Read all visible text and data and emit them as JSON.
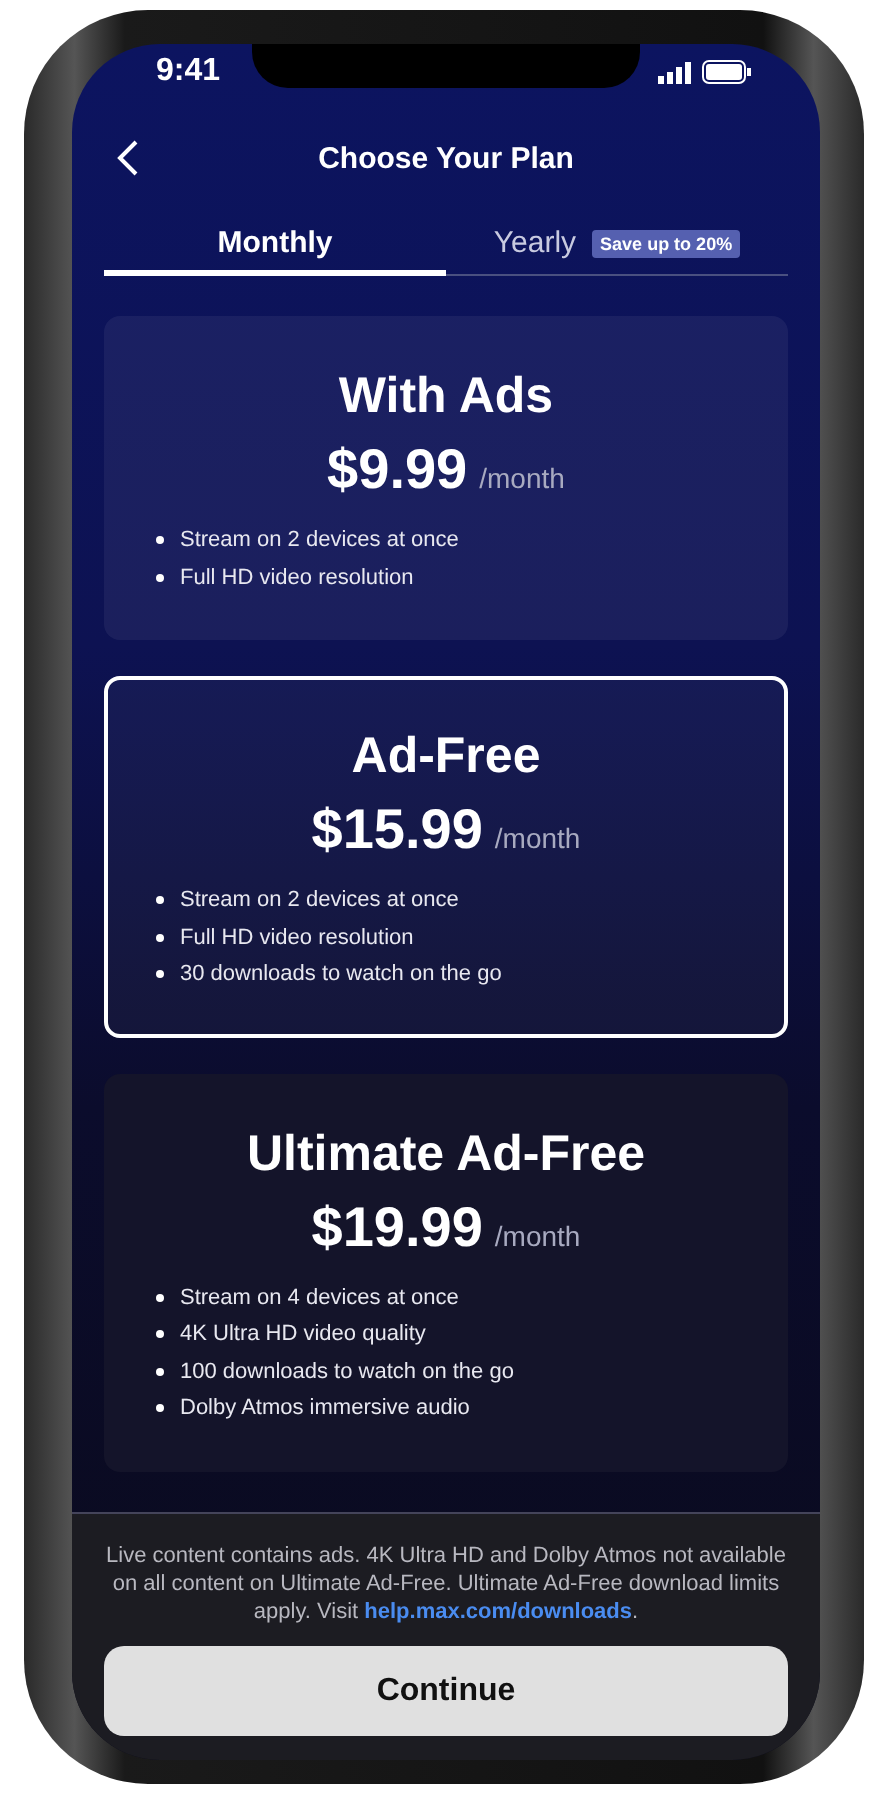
{
  "status_bar": {
    "time": "9:41"
  },
  "header": {
    "title": "Choose Your Plan"
  },
  "tabs": [
    {
      "label": "Monthly",
      "selected": true
    },
    {
      "label": "Yearly",
      "selected": false,
      "badge": "Save up to 20%"
    }
  ],
  "plans": [
    {
      "name": "With Ads",
      "price": "$9.99",
      "period": "/month",
      "selected": false,
      "features": [
        "Stream on 2 devices at once",
        "Full HD video resolution"
      ]
    },
    {
      "name": "Ad-Free",
      "price": "$15.99",
      "period": "/month",
      "selected": true,
      "features": [
        "Stream on 2 devices at once",
        "Full HD video resolution",
        "30 downloads to watch on the go"
      ]
    },
    {
      "name": "Ultimate Ad-Free",
      "price": "$19.99",
      "period": "/month",
      "selected": false,
      "features": [
        "Stream on 4 devices at once",
        "4K Ultra HD video quality",
        "100 downloads to watch on the go",
        "Dolby Atmos immersive audio"
      ]
    }
  ],
  "footer": {
    "note": "Live content contains ads. 4K Ultra HD and Dolby Atmos not available on all content on Ultimate Ad-Free. Ultimate Ad-Free download limits apply. Visit ",
    "link": "help.max.com/downloads",
    "note_end": ".",
    "button": "Continue"
  }
}
